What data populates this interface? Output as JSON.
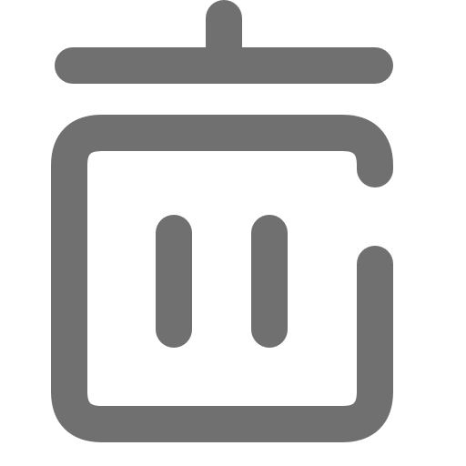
{
  "icon": {
    "name": "trash-icon",
    "color": "#707070"
  }
}
